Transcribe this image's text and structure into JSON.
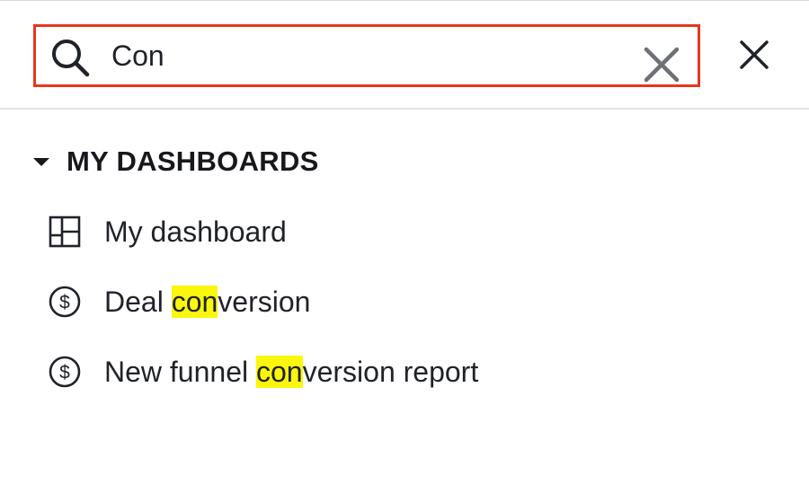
{
  "search": {
    "value": "Con",
    "placeholder": "",
    "highlight_color": "#fbf70c",
    "focus_border_color": "#e8351d"
  },
  "section": {
    "title": "MY DASHBOARDS",
    "expanded": true
  },
  "items": [
    {
      "icon": "dashboard-grid-icon",
      "pre": "My dashboard",
      "match": "",
      "post": ""
    },
    {
      "icon": "dollar-circle-icon",
      "pre": "Deal ",
      "match": "con",
      "post": "version"
    },
    {
      "icon": "dollar-circle-icon",
      "pre": "New funnel ",
      "match": "con",
      "post": "version report"
    }
  ]
}
